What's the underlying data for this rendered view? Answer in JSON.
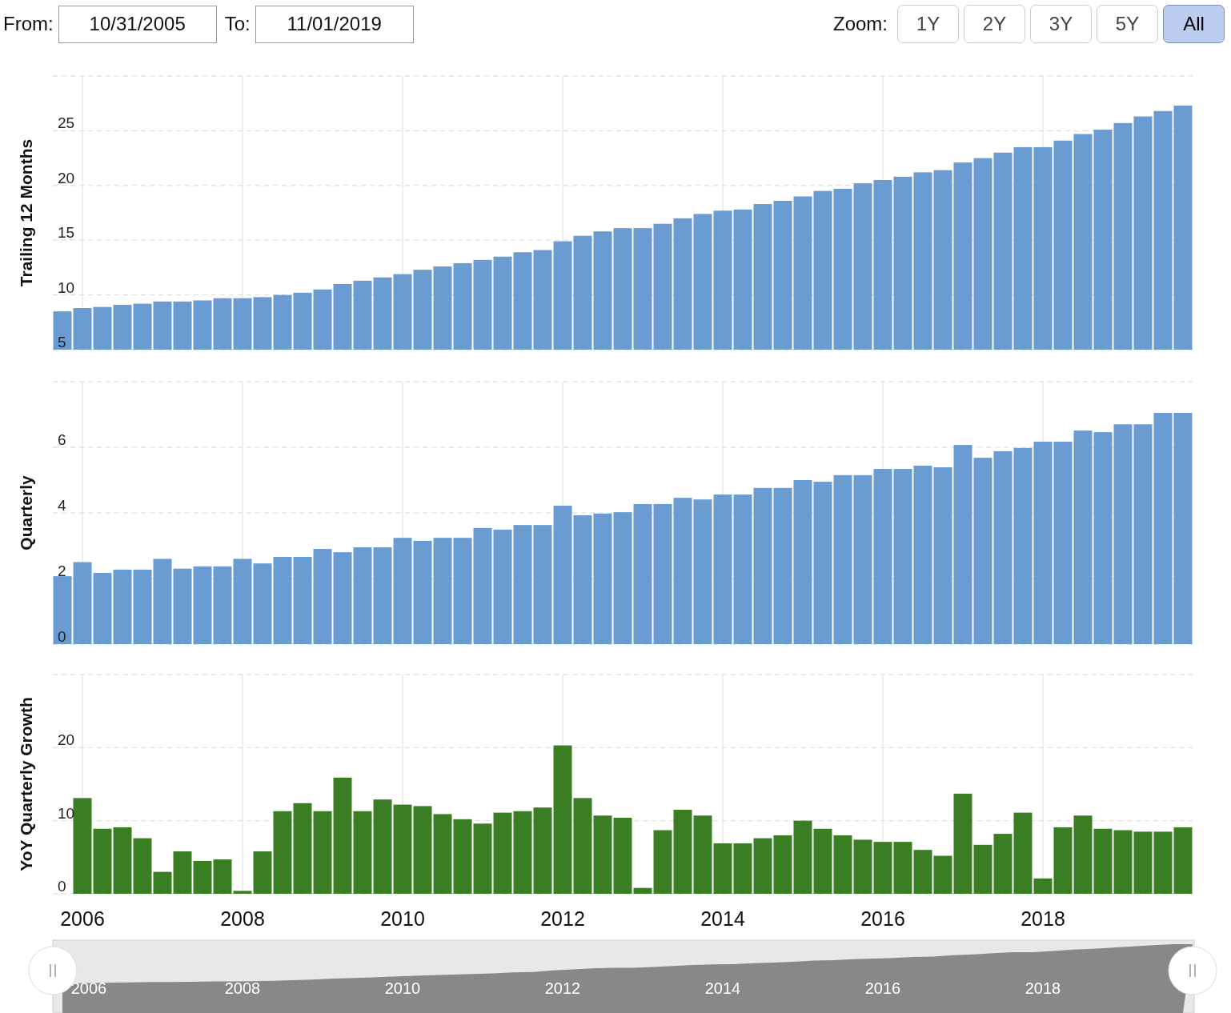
{
  "range_selector": {
    "from_label": "From:",
    "from_value": "10/31/2005",
    "to_label": "To:",
    "to_value": "11/01/2019"
  },
  "zoom": {
    "label": "Zoom:",
    "buttons": [
      {
        "label": "1Y",
        "selected": false
      },
      {
        "label": "2Y",
        "selected": false
      },
      {
        "label": "3Y",
        "selected": false
      },
      {
        "label": "5Y",
        "selected": false
      },
      {
        "label": "All",
        "selected": true
      }
    ]
  },
  "charts": [
    {
      "chart_data": {
        "type": "bar",
        "ylabel": "Trailing 12 Months",
        "x": [
          2005.75,
          2006,
          2006.25,
          2006.5,
          2006.75,
          2007,
          2007.25,
          2007.5,
          2007.75,
          2008,
          2008.25,
          2008.5,
          2008.75,
          2009,
          2009.25,
          2009.5,
          2009.75,
          2010,
          2010.25,
          2010.5,
          2010.75,
          2011,
          2011.25,
          2011.5,
          2011.75,
          2012,
          2012.25,
          2012.5,
          2012.75,
          2013,
          2013.25,
          2013.5,
          2013.75,
          2014,
          2014.25,
          2014.5,
          2014.75,
          2015,
          2015.25,
          2015.5,
          2015.75,
          2016,
          2016.25,
          2016.5,
          2016.75,
          2017,
          2017.25,
          2017.5,
          2017.75,
          2018,
          2018.25,
          2018.5,
          2018.75,
          2019,
          2019.25,
          2019.5,
          2019.75
        ],
        "series": [
          {
            "color": "#6a9bd1",
            "values": [
              8.5,
              8.8,
              8.9,
              9.1,
              9.2,
              9.4,
              9.4,
              9.5,
              9.7,
              9.7,
              9.8,
              10.0,
              10.2,
              10.5,
              11.0,
              11.3,
              11.6,
              11.9,
              12.3,
              12.6,
              12.9,
              13.2,
              13.5,
              13.9,
              14.1,
              14.9,
              15.4,
              15.8,
              16.1,
              16.1,
              16.5,
              17.0,
              17.4,
              17.7,
              17.8,
              18.3,
              18.6,
              19.0,
              19.5,
              19.7,
              20.2,
              20.5,
              20.8,
              21.2,
              21.4,
              22.1,
              22.5,
              23.0,
              23.5,
              23.5,
              24.1,
              24.7,
              25.1,
              25.7,
              26.3,
              26.8,
              27.3
            ]
          }
        ],
        "xlim": [
          2005.63,
          2019.87
        ],
        "ylim": [
          5,
          30
        ],
        "grid": true,
        "yticks": [
          5,
          10,
          15,
          20,
          25
        ]
      }
    },
    {
      "chart_data": {
        "type": "bar",
        "ylabel": "Quarterly",
        "x": [
          2005.75,
          2006,
          2006.25,
          2006.5,
          2006.75,
          2007,
          2007.25,
          2007.5,
          2007.75,
          2008,
          2008.25,
          2008.5,
          2008.75,
          2009,
          2009.25,
          2009.5,
          2009.75,
          2010,
          2010.25,
          2010.5,
          2010.75,
          2011,
          2011.25,
          2011.5,
          2011.75,
          2012,
          2012.25,
          2012.5,
          2012.75,
          2013,
          2013.25,
          2013.5,
          2013.75,
          2014,
          2014.25,
          2014.5,
          2014.75,
          2015,
          2015.25,
          2015.5,
          2015.75,
          2016,
          2016.25,
          2016.5,
          2016.75,
          2017,
          2017.25,
          2017.5,
          2017.75,
          2018,
          2018.25,
          2018.5,
          2018.75,
          2019,
          2019.25,
          2019.5,
          2019.75
        ],
        "series": [
          {
            "color": "#6a9bd1",
            "values": [
              2.07,
              2.5,
              2.17,
              2.27,
              2.27,
              2.6,
              2.3,
              2.37,
              2.37,
              2.6,
              2.46,
              2.66,
              2.66,
              2.9,
              2.8,
              2.95,
              2.95,
              3.24,
              3.15,
              3.24,
              3.24,
              3.54,
              3.49,
              3.63,
              3.63,
              4.22,
              3.93,
              3.98,
              4.02,
              4.27,
              4.27,
              4.46,
              4.41,
              4.56,
              4.56,
              4.76,
              4.76,
              5.0,
              4.95,
              5.15,
              5.15,
              5.34,
              5.34,
              5.44,
              5.39,
              6.07,
              5.68,
              5.88,
              5.98,
              6.17,
              6.17,
              6.51,
              6.46,
              6.7,
              6.7,
              7.05,
              7.05
            ]
          }
        ],
        "xlim": [
          2005.63,
          2019.87
        ],
        "ylim": [
          0,
          8
        ],
        "grid": true,
        "yticks": [
          0,
          2,
          4,
          6
        ]
      }
    },
    {
      "chart_data": {
        "type": "bar",
        "ylabel": "YoY Quarterly Growth",
        "x": [
          2006,
          2006.25,
          2006.5,
          2006.75,
          2007,
          2007.25,
          2007.5,
          2007.75,
          2008,
          2008.25,
          2008.5,
          2008.75,
          2009,
          2009.25,
          2009.5,
          2009.75,
          2010,
          2010.25,
          2010.5,
          2010.75,
          2011,
          2011.25,
          2011.5,
          2011.75,
          2012,
          2012.25,
          2012.5,
          2012.75,
          2013,
          2013.25,
          2013.5,
          2013.75,
          2014,
          2014.25,
          2014.5,
          2014.75,
          2015,
          2015.25,
          2015.5,
          2015.75,
          2016,
          2016.25,
          2016.5,
          2016.75,
          2017,
          2017.25,
          2017.5,
          2017.75,
          2018,
          2018.25,
          2018.5,
          2018.75,
          2019,
          2019.25,
          2019.5,
          2019.75
        ],
        "series": [
          {
            "color": "#3a7d23",
            "values": [
              13.1,
              8.9,
              9.1,
              7.6,
              3.0,
              5.8,
              4.5,
              4.7,
              0.4,
              5.8,
              11.3,
              12.4,
              11.3,
              15.9,
              11.3,
              12.9,
              12.2,
              12.0,
              10.9,
              10.2,
              9.6,
              11.1,
              11.3,
              11.8,
              20.3,
              13.1,
              10.7,
              10.4,
              0.8,
              8.7,
              11.5,
              10.7,
              6.9,
              6.9,
              7.6,
              8.0,
              10.0,
              8.9,
              8.0,
              7.4,
              7.1,
              7.1,
              6.0,
              5.2,
              13.7,
              6.7,
              8.2,
              11.1,
              2.1,
              9.1,
              10.7,
              8.9,
              8.7,
              8.5,
              8.5,
              9.1
            ]
          }
        ],
        "xlim": [
          2005.63,
          2019.87
        ],
        "ylim": [
          0,
          30
        ],
        "grid": true,
        "xticks": [
          2006,
          2008,
          2010,
          2012,
          2014,
          2016,
          2018
        ],
        "yticks": [
          0,
          10,
          20
        ]
      }
    }
  ],
  "navigator": {
    "labels": [
      "2006",
      "2008",
      "2010",
      "2012",
      "2014",
      "2016",
      "2018"
    ]
  }
}
